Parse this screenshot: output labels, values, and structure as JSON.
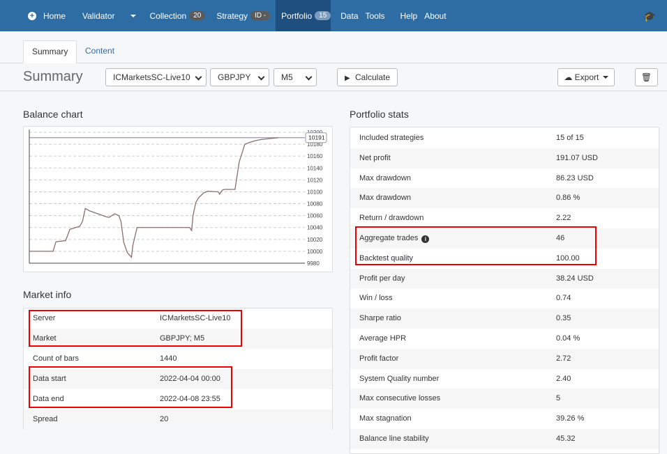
{
  "nav": {
    "home": "Home",
    "validator": "Validator",
    "collection": "Collection",
    "collection_badge": "20",
    "strategy": "Strategy",
    "strategy_badge": "ID -",
    "portfolio": "Portfolio",
    "portfolio_badge": "15",
    "data": "Data",
    "tools": "Tools",
    "help": "Help",
    "about": "About"
  },
  "tabs": {
    "summary": "Summary",
    "content": "Content"
  },
  "toolbar": {
    "title": "Summary",
    "server_select": "ICMarketsSC-Live10",
    "symbol_select": "GBPJPY",
    "period_select": "M5",
    "calculate_label": "Calculate",
    "export_label": "Export"
  },
  "balance": {
    "title": "Balance chart",
    "current_label": "10191"
  },
  "chart_data": {
    "type": "line",
    "title": "Balance chart",
    "xlabel": "",
    "ylabel": "",
    "ylim": [
      9980,
      10200
    ],
    "y_ticks": [
      9980,
      10000,
      10020,
      10040,
      10060,
      10080,
      10100,
      10120,
      10140,
      10160,
      10180,
      10200
    ],
    "x": [
      0,
      34,
      38,
      52,
      58,
      72,
      76,
      80,
      86,
      110,
      114,
      122,
      128,
      131,
      135,
      140,
      146,
      148,
      154,
      162,
      196,
      229,
      232,
      234,
      238,
      242,
      249,
      255,
      270,
      272,
      276,
      279,
      285,
      294,
      300,
      308,
      315,
      323,
      332,
      356
    ],
    "values": [
      10000,
      10000,
      10016,
      10018,
      10037,
      10042,
      10050,
      10072,
      10068,
      10058,
      10057,
      10063,
      10060,
      10050,
      10015,
      9998,
      9990,
      10010,
      10040,
      10040,
      10040,
      10040,
      10035,
      10060,
      10082,
      10090,
      10098,
      10101,
      10100,
      10096,
      10103,
      10104,
      10104,
      10104,
      10150,
      10180,
      10183,
      10186,
      10188,
      10191
    ],
    "current_value": 10191,
    "grid": true
  },
  "market": {
    "title": "Market info",
    "rows": [
      {
        "label": "Server",
        "value": "ICMarketsSC-Live10"
      },
      {
        "label": "Market",
        "value": "GBPJPY; M5"
      },
      {
        "label": "Count of bars",
        "value": "1440"
      },
      {
        "label": "Data start",
        "value": "2022-04-04 00:00"
      },
      {
        "label": "Data end",
        "value": "2022-04-08 23:55"
      },
      {
        "label": "Spread",
        "value": "20"
      }
    ]
  },
  "stats": {
    "title": "Portfolio stats",
    "rows": [
      {
        "label": "Included strategies",
        "value": "15 of 15"
      },
      {
        "label": "Net profit",
        "value": "191.07 USD"
      },
      {
        "label": "Max drawdown",
        "value": "86.23 USD"
      },
      {
        "label": "Max drawdown",
        "value": "0.86 %"
      },
      {
        "label": "Return / drawdown",
        "value": "2.22"
      },
      {
        "label": "Aggregate trades",
        "value": "46"
      },
      {
        "label": "Backtest quality",
        "value": "100.00"
      },
      {
        "label": "Profit per day",
        "value": "38.24 USD"
      },
      {
        "label": "Win / loss",
        "value": "0.74"
      },
      {
        "label": "Sharpe ratio",
        "value": "0.35"
      },
      {
        "label": "Average HPR",
        "value": "0.04 %"
      },
      {
        "label": "Profit factor",
        "value": "2.72"
      },
      {
        "label": "System Quality number",
        "value": "2.40"
      },
      {
        "label": "Max consecutive losses",
        "value": "5"
      },
      {
        "label": "Max stagnation",
        "value": "39.26 %"
      },
      {
        "label": "Balance line stability",
        "value": "45.32"
      }
    ]
  },
  "colors": {
    "navbar": "#2e6da4",
    "highlight": "#ee0000",
    "line": "#8a6e6e",
    "reference": "#7777cc"
  }
}
